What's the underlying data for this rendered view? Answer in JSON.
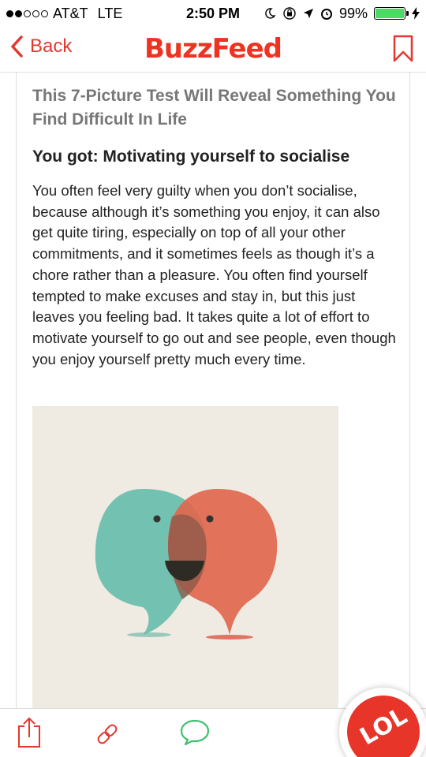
{
  "status_bar": {
    "carrier": "AT&T",
    "network": "LTE",
    "time": "2:50 PM",
    "battery": "99%",
    "battery_level": 0.99,
    "signal_bars_filled": 2,
    "signal_bars_total": 5
  },
  "nav": {
    "back_label": "Back",
    "brand": "BuzzFeed"
  },
  "article": {
    "quiz_title": "This 7-Picture Test Will Reveal Something You Find Difficult In Life",
    "result_title": "You got: Motivating yourself to socialise",
    "result_text": "You often feel very guilty when you don’t socialise, because although it’s something you enjoy, it can also get quite tiring, especially on top of all your other commitments, and it sometimes feels as though it’s a chore rather than a pleasure. You often find yourself tempted to make excuses and stay in, but this just leaves you feeling bad. It takes quite a lot of effort to motivate yourself to go out and see people, even though you enjoy yourself pretty much every time."
  },
  "toolbar": {
    "share_icon": "share-icon",
    "link_icon": "link-icon",
    "comment_icon": "comment-icon",
    "reaction_label": "LOL"
  },
  "colors": {
    "accent": "#e8352a",
    "teal_bubble": "#6cbfae",
    "red_bubble": "#e2674e",
    "comment_green": "#3fbf6f",
    "illustration_bg": "#efebe3"
  }
}
